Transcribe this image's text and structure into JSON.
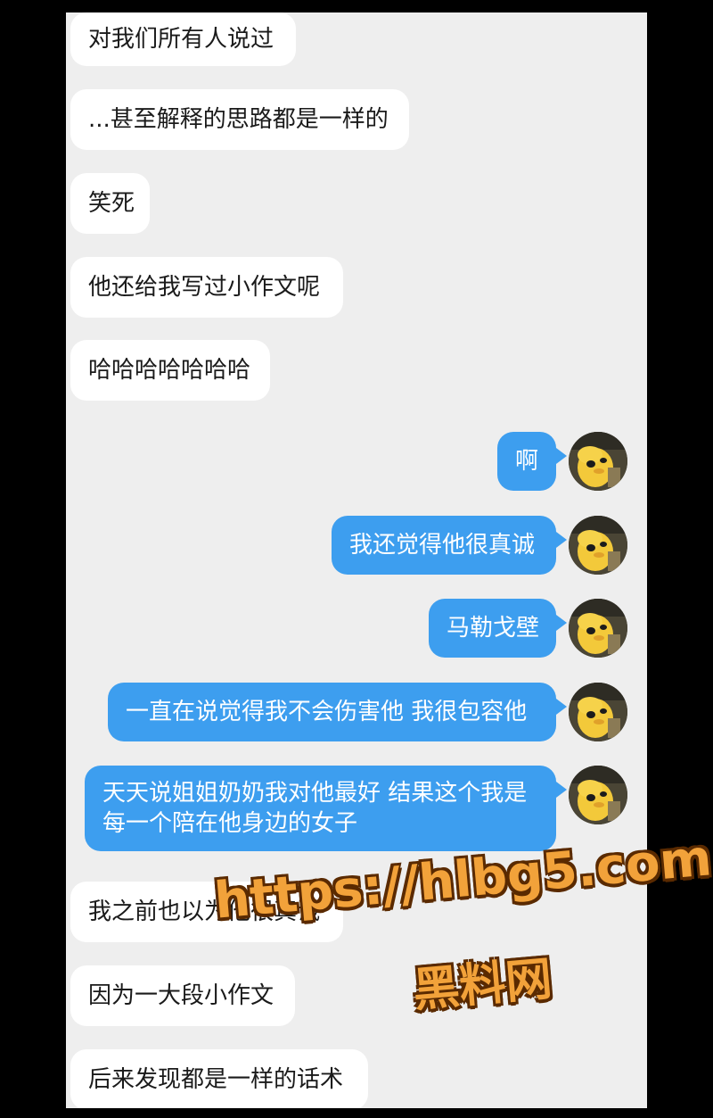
{
  "chat": {
    "incoming_top": [
      "对我们所有人说过",
      "...甚至解释的思路都是一样的",
      "笑死",
      "他还给我写过小作文呢",
      "哈哈哈哈哈哈哈"
    ],
    "outgoing": [
      "啊",
      "我还觉得他很真诚",
      "马勒戈壁",
      "一直在说觉得我不会伤害他 我很包容他",
      "天天说姐姐奶奶我对他最好 结果这个我是每一个陪在他身边的女子"
    ],
    "incoming_bottom": [
      "我之前也以为他很真诚",
      "因为一大段小作文",
      "后来发现都是一样的话术"
    ]
  },
  "avatar": {
    "icon": "cartoon-dog-avatar-icon"
  },
  "colors": {
    "outgoing_bubble": "#3d9eef",
    "incoming_bubble": "#ffffff",
    "background": "#eeeeee"
  },
  "watermark": {
    "line1": "https://hlbg5.com",
    "line2": "黑料网"
  }
}
